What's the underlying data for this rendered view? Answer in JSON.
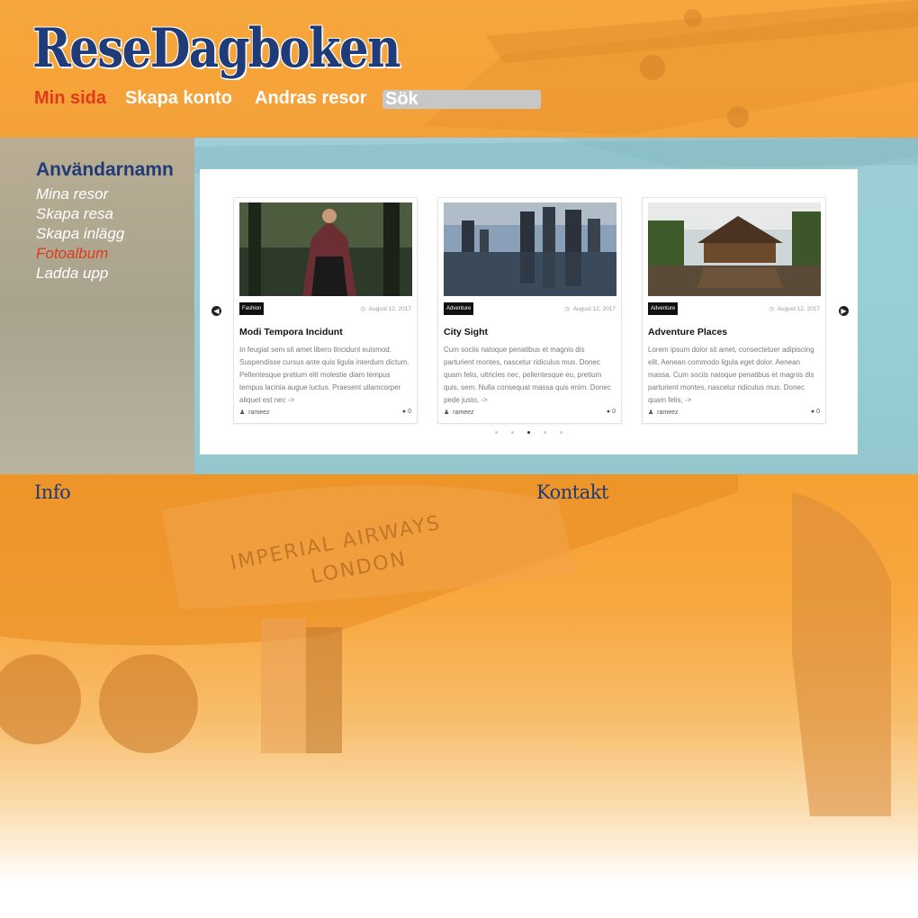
{
  "header": {
    "logo": "ReseDagboken",
    "nav": [
      {
        "label": "Min sida",
        "active": true
      },
      {
        "label": "Skapa konto",
        "active": false
      },
      {
        "label": "Andras resor",
        "active": false
      }
    ],
    "search_placeholder": "Sök"
  },
  "sidebar": {
    "username": "Användarnamn",
    "items": [
      {
        "label": "Mina resor",
        "active": false
      },
      {
        "label": "Skapa resa",
        "active": false
      },
      {
        "label": "Skapa inlägg",
        "active": false
      },
      {
        "label": "Fotoalbum",
        "active": true
      },
      {
        "label": "Ladda upp",
        "active": false
      }
    ]
  },
  "carousel": {
    "cards": [
      {
        "tag": "Fashion",
        "date": "August 12, 2017",
        "title": "Modi Tempora Incidunt",
        "text": "In feugiat sem sit amet libero tincidunt euismod. Suspendisse cursus ante quis ligula interdum dictum. Pellentesque pretium elit molestie diam tempus tempus lacinia augue luctus. Praesent ullamcorper aliquet est nec ->",
        "author": "rameez",
        "comments": "0"
      },
      {
        "tag": "Adventure",
        "date": "August 12, 2017",
        "title": "City Sight",
        "text": "Cum sociis natoque penatibus et magnis dis parturient montes, nascetur ridiculus mus. Donec quam felis, ultricies nec, pellentesque eu, pretium quis, sem. Nulla consequat massa quis enim. Donec pede justo, ->",
        "author": "rameez",
        "comments": "0"
      },
      {
        "tag": "Adventure",
        "date": "August 12, 2017",
        "title": "Adventure Places",
        "text": "Lorem ipsum dolor sit amet, consectetuer adipiscing elit. Aenean commodo ligula eget dolor. Aenean massa. Cum sociis natoque penatibus et magnis dis parturient montes, nascetur ridiculus mus. Donec quam felis, ->",
        "author": "rameez",
        "comments": "0"
      }
    ],
    "dots_count": 5,
    "active_dot": 2
  },
  "footer": {
    "info": "Info",
    "contact": "Kontakt"
  },
  "background_text": {
    "line1": "IMPERIAL AIRWAYS",
    "line2": "LONDON"
  },
  "colors": {
    "brand_blue": "#1f3b78",
    "active_red": "#e03a1a",
    "header_orange": "#f5a63c",
    "middle_blue": "#9ccfd8"
  }
}
